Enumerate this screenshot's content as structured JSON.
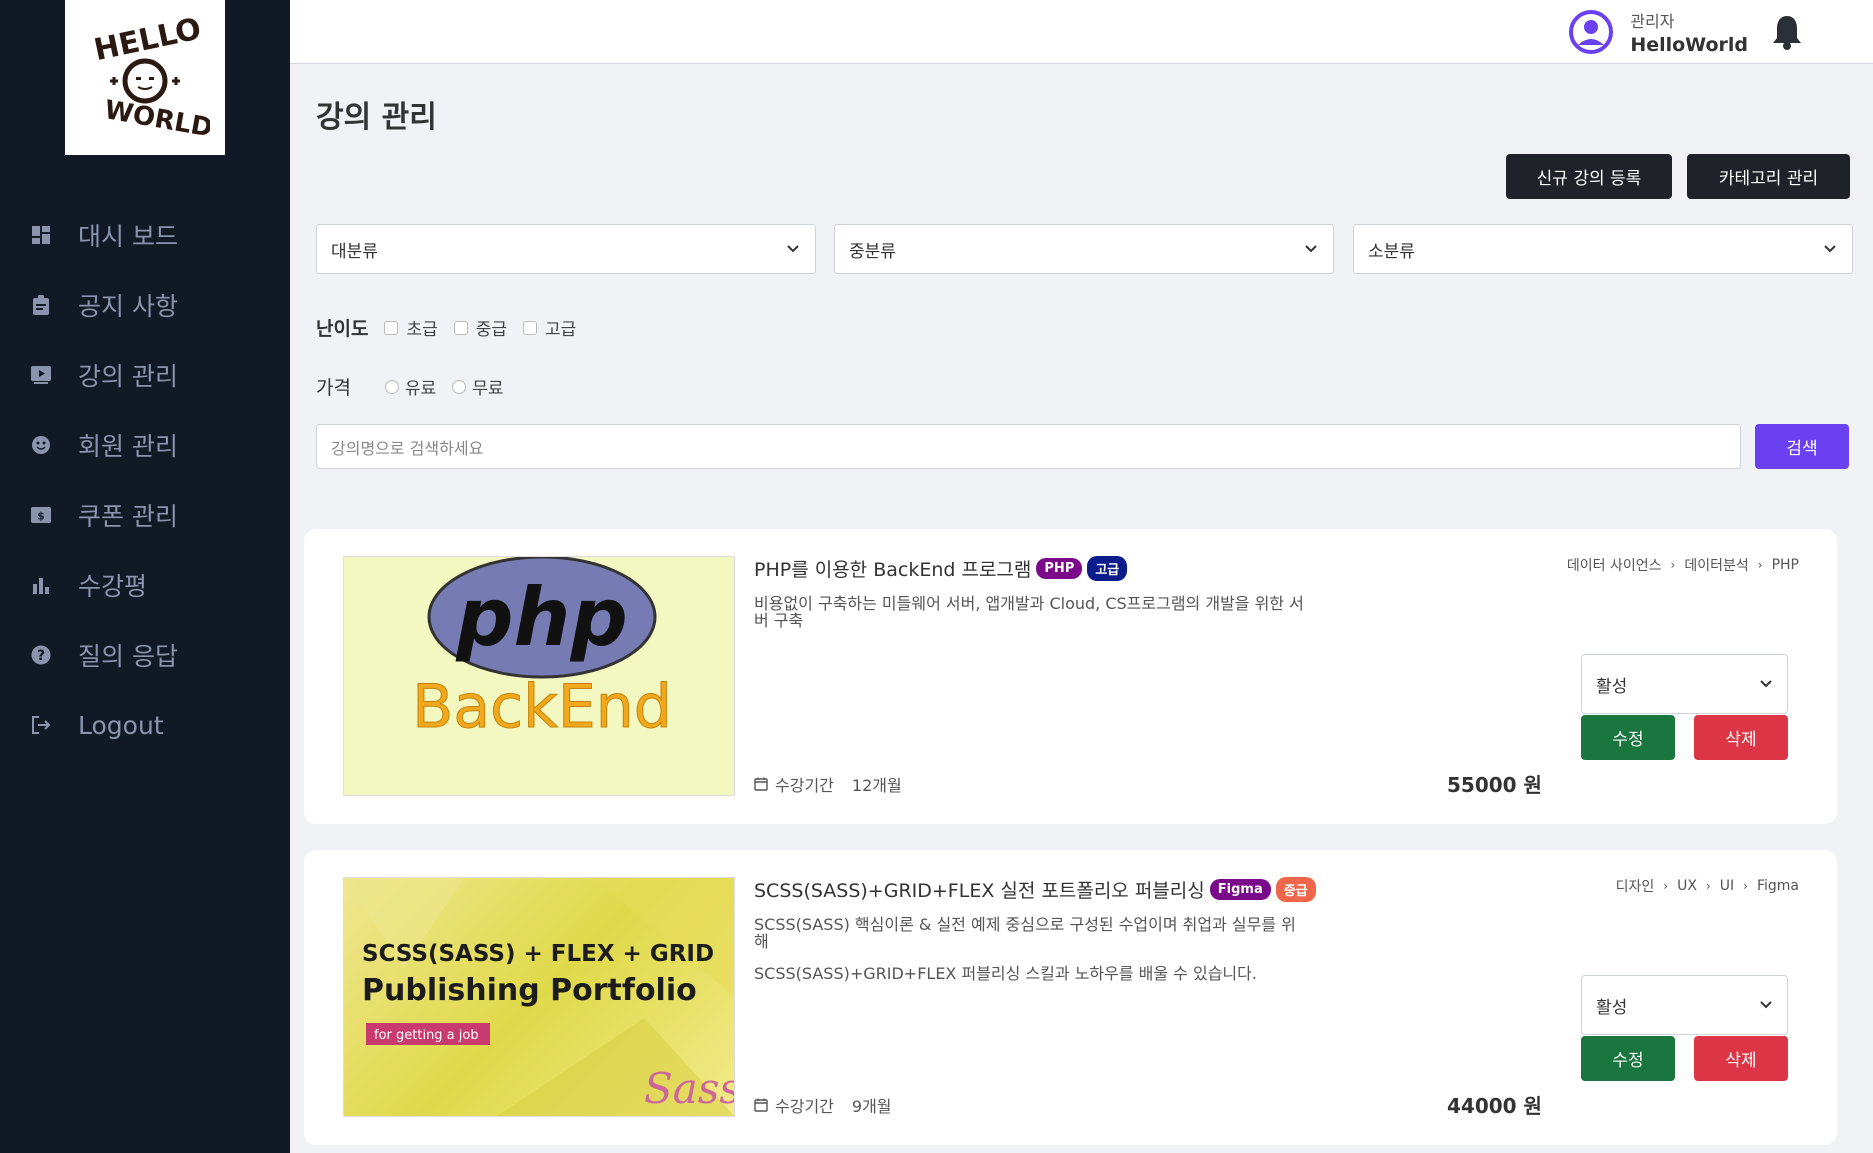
{
  "header": {
    "user_role": "관리자",
    "user_name": "HelloWorld"
  },
  "sidebar": {
    "items": [
      {
        "label": "대시 보드",
        "icon": "dashboard-icon"
      },
      {
        "label": "공지 사항",
        "icon": "clipboard-icon"
      },
      {
        "label": "강의 관리",
        "icon": "video-icon"
      },
      {
        "label": "회원 관리",
        "icon": "smile-icon"
      },
      {
        "label": "쿠폰 관리",
        "icon": "dollar-icon"
      },
      {
        "label": "수강평",
        "icon": "bar-chart-icon"
      },
      {
        "label": "질의 응답",
        "icon": "question-icon"
      },
      {
        "label": "Logout",
        "icon": "logout-icon"
      }
    ]
  },
  "page": {
    "title": "강의 관리",
    "new_button": "신규 강의 등록",
    "category_button": "카테고리 관리"
  },
  "filters": {
    "category1": "대분류",
    "category2": "중분류",
    "category3": "소분류",
    "level_label": "난이도",
    "levels": [
      "초급",
      "중급",
      "고급"
    ],
    "price_label": "가격",
    "prices": [
      "유료",
      "무료"
    ],
    "search_placeholder": "강의명으로 검색하세요",
    "search_button": "검색"
  },
  "courses": [
    {
      "title": "PHP를 이용한 BackEnd 프로그램",
      "tag": "PHP",
      "tag_color": "#7a0a8a",
      "level": "고급",
      "level_color": "#0b1d8a",
      "desc": [
        "비용없이 구축하는 미들웨어 서버, 앱개발과 Cloud, CS프로그램의 개발을 위한 서버 구축"
      ],
      "breadcrumb": [
        "데이터 사이언스",
        "데이터분석",
        "PHP"
      ],
      "period_label": "수강기간",
      "period": "12개월",
      "price": "55000 원",
      "status": "활성",
      "edit": "수정",
      "delete": "삭제",
      "thumb_text": [
        "php",
        "BackEnd"
      ]
    },
    {
      "title": "SCSS(SASS)+GRID+FLEX 실전 포트폴리오 퍼블리싱",
      "tag": "Figma",
      "tag_color": "#7a0a8a",
      "level": "중급",
      "level_color": "#f0664a",
      "desc": [
        "SCSS(SASS) 핵심이론 & 실전 예제 중심으로 구성된 수업이며 취업과 실무를 위해",
        "SCSS(SASS)+GRID+FLEX 퍼블리싱 스킬과 노하우를 배울 수 있습니다."
      ],
      "breadcrumb": [
        "디자인",
        "UX",
        "UI",
        "Figma"
      ],
      "period_label": "수강기간",
      "period": "9개월",
      "price": "44000 원",
      "status": "활성",
      "edit": "수정",
      "delete": "삭제",
      "thumb_text": [
        "SCSS(SASS) + FLEX + GRID",
        "Publishing Portfolio",
        "for getting a job",
        "Sass"
      ]
    }
  ]
}
